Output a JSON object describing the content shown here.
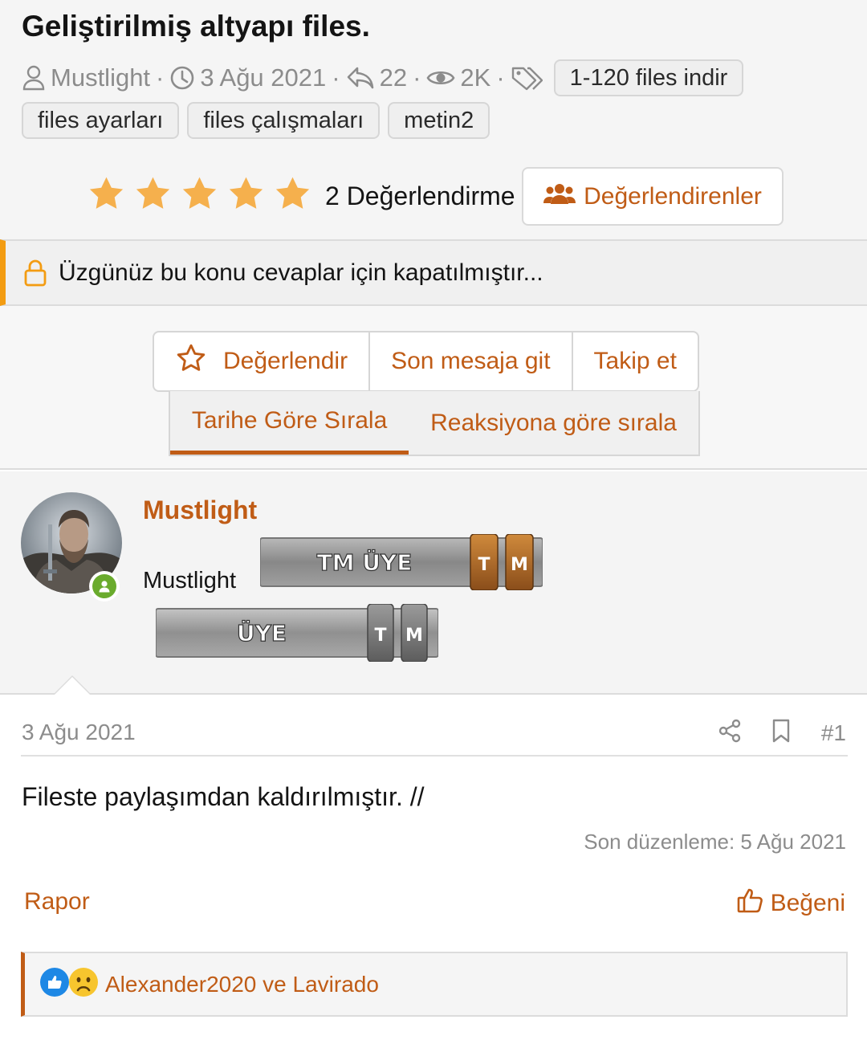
{
  "thread": {
    "title": "Geliştirilmiş altyapı files.",
    "author": "Mustlight",
    "date": "3 Ağu 2021",
    "replies": "22",
    "views": "2K",
    "tags": [
      "1-120 files indir",
      "files ayarları",
      "files çalışmaları",
      "metin2"
    ]
  },
  "rating": {
    "stars": 5,
    "max": 5,
    "count_label": "2 Değerlendirme",
    "raters_button": "Değerlendirenler"
  },
  "notice": {
    "locked_text": "Üzgünüz bu konu cevaplar için kapatılmıştır..."
  },
  "actions": {
    "rate": "Değerlendir",
    "last_post": "Son mesaja git",
    "follow": "Takip et"
  },
  "sort": {
    "by_date": "Tarihe Göre Sırala",
    "by_reaction": "Reaksiyona göre sırala",
    "active": "by_date"
  },
  "post": {
    "author": "Mustlight",
    "user_title": "Mustlight",
    "banners": [
      {
        "text": "TM ÜYE",
        "badges": [
          "T",
          "M"
        ]
      },
      {
        "text": "ÜYE",
        "badges": [
          "T",
          "M"
        ]
      }
    ],
    "date": "3 Ağu 2021",
    "number": "#1",
    "body": "Fileste paylaşımdan kaldırılmıştır. //",
    "edited": "Son düzenleme: 5 Ağu 2021",
    "report": "Rapor",
    "like": "Beğeni",
    "reactions_by": "Alexander2020 ve Lavirado"
  },
  "colors": {
    "accent": "#c05c16",
    "star": "#f5b04d",
    "lock": "#f39c12",
    "online": "#6aab2d"
  },
  "icons": [
    "user-icon",
    "clock-icon",
    "reply-icon",
    "eye-icon",
    "tags-icon",
    "star-icon",
    "users-icon",
    "lock-icon",
    "star-outline-icon",
    "share-icon",
    "bookmark-icon",
    "thumbs-up-icon",
    "like-reaction-icon",
    "sad-reaction-icon"
  ]
}
